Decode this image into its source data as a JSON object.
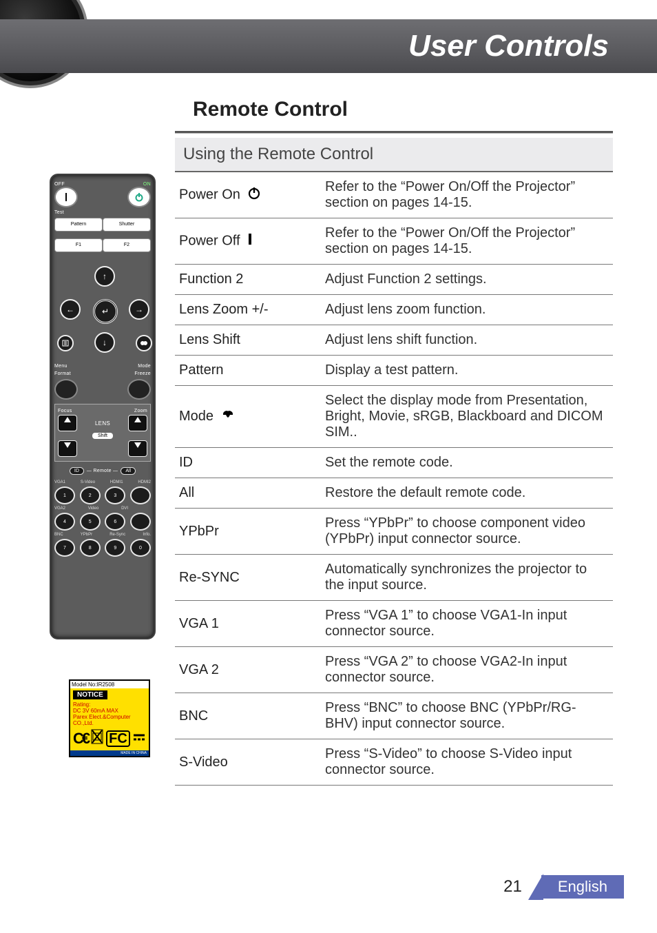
{
  "banner_title": "User Controls",
  "section_title": "Remote Control",
  "table_header": "Using the Remote Control",
  "rows": [
    {
      "key": "Power On",
      "desc": "Refer to the “Power On/Off the Projector” section on pages 14-15.",
      "icon": "power-on-icon"
    },
    {
      "key": "Power Off",
      "desc": "Refer to the “Power On/Off the Projector” section on pages 14-15.",
      "icon": "power-off-icon"
    },
    {
      "key": "Function 2",
      "desc": "Adjust Function 2 settings."
    },
    {
      "key": "Lens Zoom +/-",
      "desc": "Adjust lens zoom function."
    },
    {
      "key": "Lens Shift",
      "desc": "Adjust lens shift function."
    },
    {
      "key": "Pattern",
      "desc": "Display a test pattern."
    },
    {
      "key": "Mode",
      "desc": "Select the display mode from Presentation, Bright, Movie, sRGB, Blackboard and DICOM SIM..",
      "icon": "mode-icon"
    },
    {
      "key": "ID",
      "desc": "Set the remote code."
    },
    {
      "key": "All",
      "desc": "Restore the default remote code."
    },
    {
      "key": "YPbPr",
      "desc": "Press “YPbPr” to choose component video (YPbPr) input connector source."
    },
    {
      "key": "Re-SYNC",
      "desc": "Automatically synchronizes the projector to the input source."
    },
    {
      "key": "VGA 1",
      "desc": "Press “VGA 1” to choose VGA1-In input connector source."
    },
    {
      "key": "VGA 2",
      "desc": "Press “VGA 2” to choose VGA2-In input connector source."
    },
    {
      "key": "BNC",
      "desc": "Press “BNC” to choose BNC (YPbPr/RG-BHV) input connector source."
    },
    {
      "key": "S-Video",
      "desc": "Press “S-Video” to choose S-Video input connector source."
    }
  ],
  "remote": {
    "off": "OFF",
    "on": "ON",
    "test": "Test",
    "pattern": "Pattern",
    "shutter": "Shutter",
    "f1": "F1",
    "f2": "F2",
    "menu": "Menu",
    "mode": "Mode",
    "format": "Format",
    "freeze": "Freeze",
    "focus": "Focus",
    "zoom": "Zoom",
    "lens": "LENS",
    "shift": "Shift",
    "id": "ID",
    "remote": "Remote",
    "all": "All",
    "srcrow1": [
      "VGA1",
      "S-Video",
      "HDMI1",
      "HDMI2"
    ],
    "nums1": [
      "1",
      "2",
      "3",
      ""
    ],
    "srcrow2": [
      "VGA2",
      "Video",
      "DVI",
      ""
    ],
    "nums2": [
      "4",
      "5",
      "6",
      ""
    ],
    "srcrow3": [
      "BNC",
      "YPbPr",
      "Re-Sync",
      "Info."
    ],
    "nums3": [
      "7",
      "8",
      "9",
      "0"
    ]
  },
  "notice": {
    "model": "Model No:IR2508",
    "header": "NOTICE",
    "lines": [
      "Rating:",
      "DC 3V 60mA MAX",
      "Parex Elect.&Computer",
      "CO.,Ltd."
    ],
    "made_in": "MADE IN CHINA"
  },
  "footer": {
    "page": "21",
    "language": "English"
  }
}
